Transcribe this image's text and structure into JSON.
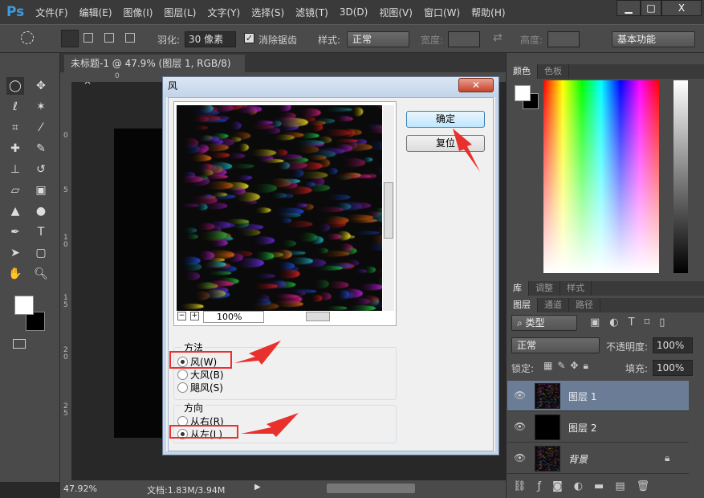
{
  "app": {
    "logo": "Ps",
    "menu": [
      "文件(F)",
      "编辑(E)",
      "图像(I)",
      "图层(L)",
      "文字(Y)",
      "选择(S)",
      "滤镜(T)",
      "3D(D)",
      "视图(V)",
      "窗口(W)",
      "帮助(H)"
    ],
    "window_buttons": [
      "▁",
      "□",
      "X"
    ]
  },
  "options": {
    "feather_label": "羽化:",
    "feather_value": "30 像素",
    "antialias_label": "消除锯齿",
    "antialias_checked": true,
    "style_label": "样式:",
    "style_value": "正常",
    "width_label": "宽度:",
    "height_label": "高度:",
    "workspace": "基本功能"
  },
  "document": {
    "tab_title": "未标题-1 @ 47.9% (图层 1, RGB/8) *",
    "tab_close": "×",
    "zoom": "47.92%",
    "doc_info": "文档:1.83M/3.94M",
    "ruler_left": [
      "0",
      "5",
      "1\n0",
      "1\n5",
      "2\n0",
      "2\n5"
    ],
    "ruler_top": [
      "0"
    ]
  },
  "dialog": {
    "title": "风",
    "close": "✕",
    "ok": "确定",
    "reset": "复位",
    "preview_zoom": "100%",
    "method": {
      "label": "方法",
      "options": [
        {
          "label": "风(W)",
          "selected": true
        },
        {
          "label": "大风(B)",
          "selected": false
        },
        {
          "label": "飓风(S)",
          "selected": false
        }
      ]
    },
    "direction": {
      "label": "方向",
      "options": [
        {
          "label": "从右(R)",
          "selected": false
        },
        {
          "label": "从左(L)",
          "selected": true
        }
      ]
    }
  },
  "color_panel": {
    "tabs": [
      "颜色",
      "色板"
    ],
    "foreground": "#ffffff",
    "background": "#000000"
  },
  "library_tabs": [
    "库",
    "调整",
    "样式"
  ],
  "layers_panel": {
    "tabs": [
      "图层",
      "通道",
      "路径"
    ],
    "filter": "类型",
    "blend_mode": "正常",
    "opacity_label": "不透明度:",
    "opacity": "100%",
    "lock_label": "锁定:",
    "fill_label": "填充:",
    "fill": "100%",
    "layers": [
      {
        "name": "图层 1",
        "selected": true
      },
      {
        "name": "图层 2",
        "selected": false
      },
      {
        "name": "背景",
        "selected": false,
        "locked": true
      }
    ]
  },
  "colors": {
    "accent_red": "#e8312d",
    "selected_layer": "#6b7d96"
  }
}
